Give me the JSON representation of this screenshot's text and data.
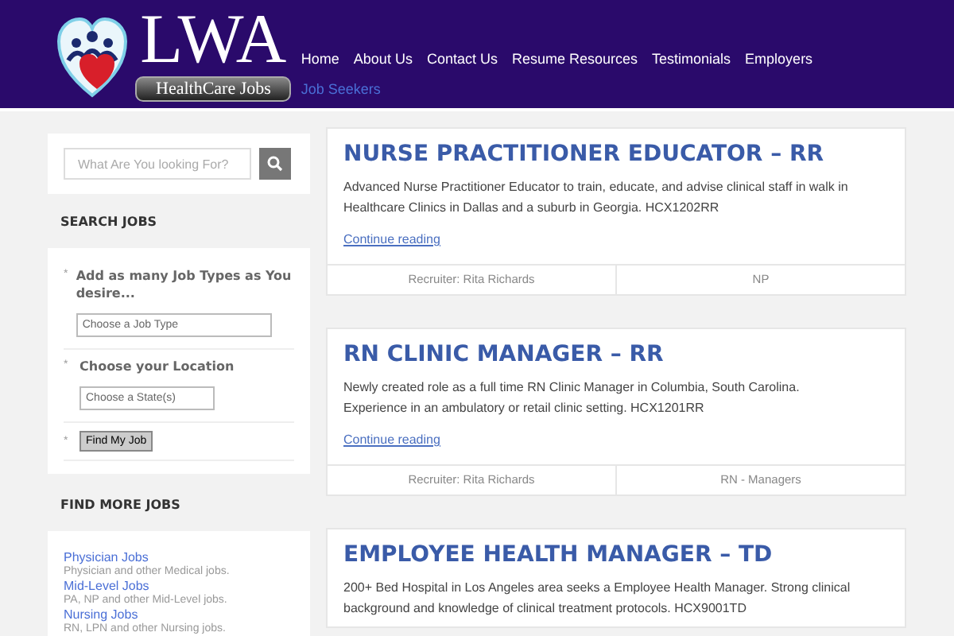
{
  "logo": {
    "title": "LWA",
    "subtitle": "HealthCare Jobs"
  },
  "nav": [
    {
      "label": "Home",
      "selected": false
    },
    {
      "label": "About Us",
      "selected": false
    },
    {
      "label": "Contact Us",
      "selected": false
    },
    {
      "label": "Resume Resources",
      "selected": false
    },
    {
      "label": "Testimonials",
      "selected": false
    },
    {
      "label": "Employers",
      "selected": false
    },
    {
      "label": "Job Seekers",
      "selected": true
    }
  ],
  "sidebar": {
    "search": {
      "placeholder": "What Are You looking For?"
    },
    "search_jobs": {
      "heading": "SEARCH JOBS",
      "bullet": "*",
      "fields": [
        {
          "label": "Add as many Job Types as You desire...",
          "placeholder": "Choose a Job Type"
        },
        {
          "label": "Choose your Location",
          "placeholder": "Choose a State(s)"
        }
      ],
      "button": "Find My Job"
    },
    "find_more": {
      "heading": "FIND MORE JOBS",
      "items": [
        {
          "link": "Physician Jobs",
          "description": "Physician and other Medical jobs."
        },
        {
          "link": "Mid-Level Jobs",
          "description": "PA, NP and other Mid-Level jobs."
        },
        {
          "link": "Nursing Jobs",
          "description": "RN, LPN and other Nursing jobs."
        }
      ]
    }
  },
  "posts": [
    {
      "title": "NURSE PRACTITIONER EDUCATOR – RR",
      "excerpt": "Advanced Nurse Practitioner Educator to train, educate, and advise clinical staff in walk in Healthcare Clinics in Dallas and a suburb in Georgia. HCX1202RR",
      "more": "Continue reading",
      "recruiter": "Recruiter: Rita Richards",
      "category": "NP"
    },
    {
      "title": "RN CLINIC MANAGER – RR",
      "excerpt": "Newly created role as a full time RN Clinic Manager in Columbia, South Carolina. Experience in an ambulatory or retail clinic setting. HCX1201RR",
      "more": "Continue reading",
      "recruiter": "Recruiter: Rita Richards",
      "category": "RN - Managers"
    },
    {
      "title": "EMPLOYEE HEALTH MANAGER – TD",
      "excerpt": "200+ Bed Hospital in Los Angeles area seeks a Employee Health Manager. Strong clinical background and knowledge of clinical treatment protocols. HCX9001TD"
    }
  ]
}
